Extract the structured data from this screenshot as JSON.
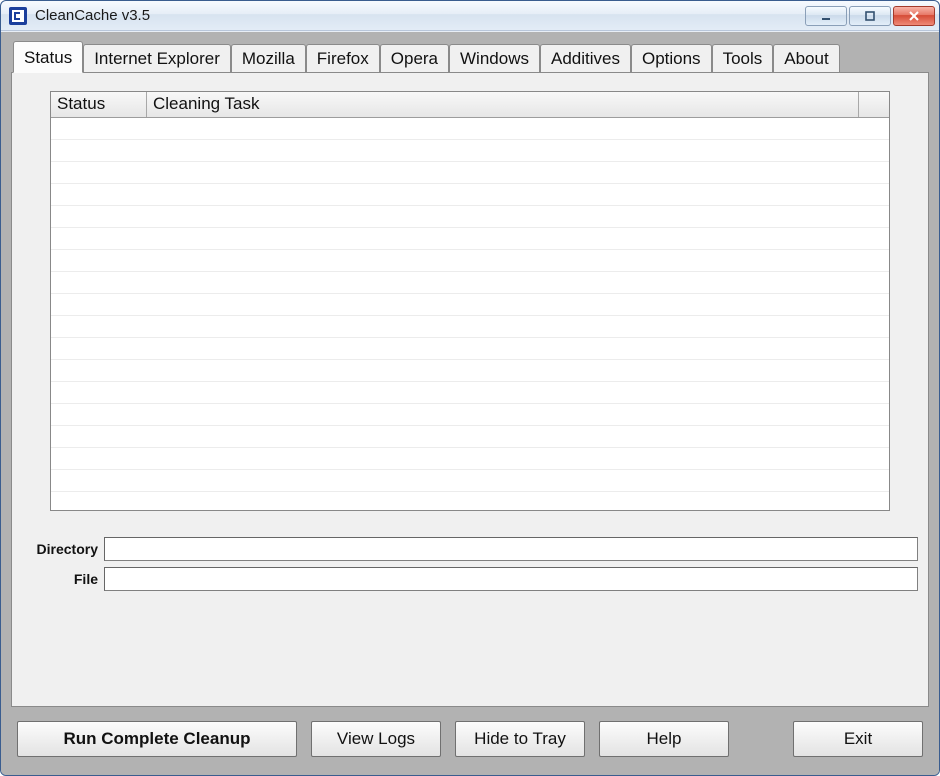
{
  "window": {
    "title": "CleanCache v3.5"
  },
  "tabs": [
    {
      "label": "Status",
      "active": true
    },
    {
      "label": "Internet Explorer"
    },
    {
      "label": "Mozilla"
    },
    {
      "label": "Firefox"
    },
    {
      "label": "Opera"
    },
    {
      "label": "Windows"
    },
    {
      "label": "Additives"
    },
    {
      "label": "Options"
    },
    {
      "label": "Tools"
    },
    {
      "label": "About"
    }
  ],
  "statusTab": {
    "columns": {
      "status": "Status",
      "task": "Cleaning Task"
    },
    "rows": [],
    "fields": {
      "directoryLabel": "Directory",
      "directoryValue": "",
      "fileLabel": "File",
      "fileValue": ""
    }
  },
  "buttons": {
    "runCleanup": "Run Complete Cleanup",
    "viewLogs": "View Logs",
    "hideToTray": "Hide to Tray",
    "help": "Help",
    "exit": "Exit"
  }
}
